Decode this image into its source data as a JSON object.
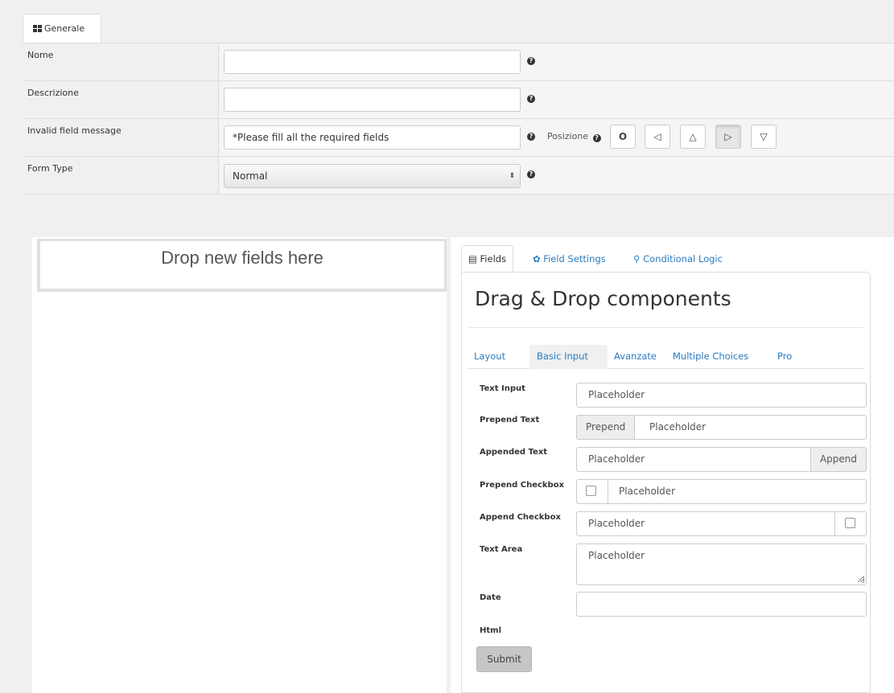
{
  "tabs": {
    "general_label": "Generale"
  },
  "settings": {
    "rows": [
      {
        "label": "Nome",
        "value": ""
      },
      {
        "label": "Descrizione",
        "value": ""
      },
      {
        "label": "Invalid field message",
        "value": "*Please fill all the required fields"
      },
      {
        "label": "Form Type",
        "value": "Normal"
      }
    ],
    "help_glyph": "?",
    "position_label": "Posizione",
    "position_buttons": [
      {
        "icon": "circle-outline-icon",
        "glyph": "O"
      },
      {
        "icon": "point-left-icon",
        "glyph": "◁"
      },
      {
        "icon": "point-up-icon",
        "glyph": "△"
      },
      {
        "icon": "point-right-icon",
        "glyph": "▷"
      },
      {
        "icon": "point-down-icon",
        "glyph": "▽"
      }
    ],
    "active_position": "point-right-icon",
    "select_caret": "⬍"
  },
  "builder": {
    "drop_text": "Drop new fields here",
    "right_tabs": [
      {
        "label": "Fields",
        "icon": "list-icon",
        "glyph": "▤"
      },
      {
        "label": "Field Settings",
        "icon": "gear-icon",
        "glyph": "✿"
      },
      {
        "label": "Conditional Logic",
        "icon": "link-icon",
        "glyph": "⚲"
      }
    ],
    "title": "Drag & Drop components",
    "component_tabs": [
      "Layout",
      "Basic Input",
      "Avanzate",
      "Multiple Choices",
      "Pro"
    ],
    "active_component_tab": "Basic Input",
    "fields": {
      "text_input": {
        "label": "Text Input",
        "placeholder": "Placeholder"
      },
      "prepend_text": {
        "label": "Prepend Text",
        "addon": "Prepend",
        "placeholder": "Placeholder"
      },
      "appended_text": {
        "label": "Appended Text",
        "addon": "Append",
        "placeholder": "Placeholder"
      },
      "prepend_checkbox": {
        "label": "Prepend Checkbox",
        "placeholder": "Placeholder"
      },
      "append_checkbox": {
        "label": "Append Checkbox",
        "placeholder": "Placeholder"
      },
      "text_area": {
        "label": "Text Area",
        "placeholder": "Placeholder"
      },
      "date": {
        "label": "Date",
        "value": ""
      },
      "html": {
        "label": "Html"
      }
    },
    "submit_label": "Submit"
  },
  "colors": {
    "link": "#2a7bc0",
    "border": "#dddddd",
    "background": "#f0f0f0"
  }
}
